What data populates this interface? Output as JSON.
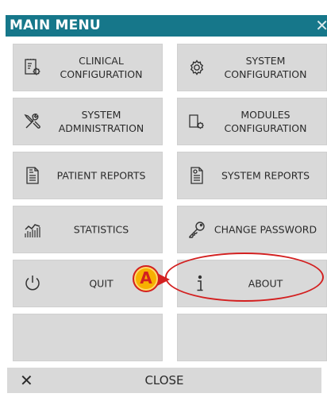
{
  "window": {
    "title": "MAIN MENU",
    "close_glyph": "✕"
  },
  "tiles": [
    {
      "icon": "clinical-config-icon",
      "label": "CLINICAL\nCONFIGURATION"
    },
    {
      "icon": "gear-icon",
      "label": "SYSTEM\nCONFIGURATION"
    },
    {
      "icon": "tools-icon",
      "label": "SYSTEM\nADMINISTRATION"
    },
    {
      "icon": "modules-config-icon",
      "label": "MODULES\nCONFIGURATION"
    },
    {
      "icon": "document-icon",
      "label": "PATIENT REPORTS"
    },
    {
      "icon": "document-icon",
      "label": "SYSTEM REPORTS"
    },
    {
      "icon": "statistics-icon",
      "label": "STATISTICS"
    },
    {
      "icon": "key-icon",
      "label": "CHANGE PASSWORD"
    },
    {
      "icon": "power-icon",
      "label": "QUIT"
    },
    {
      "icon": "info-icon",
      "label": "ABOUT"
    },
    {
      "icon": "",
      "label": ""
    },
    {
      "icon": "",
      "label": ""
    }
  ],
  "close_bar": {
    "icon": "close-icon",
    "glyph": "✕",
    "label": "CLOSE"
  },
  "callout": {
    "badge_letter": "A",
    "ring_color": "#d32020",
    "badge_color": "#f7b000"
  },
  "colors": {
    "titlebar": "#16778a",
    "tile": "#d9d9d9"
  }
}
